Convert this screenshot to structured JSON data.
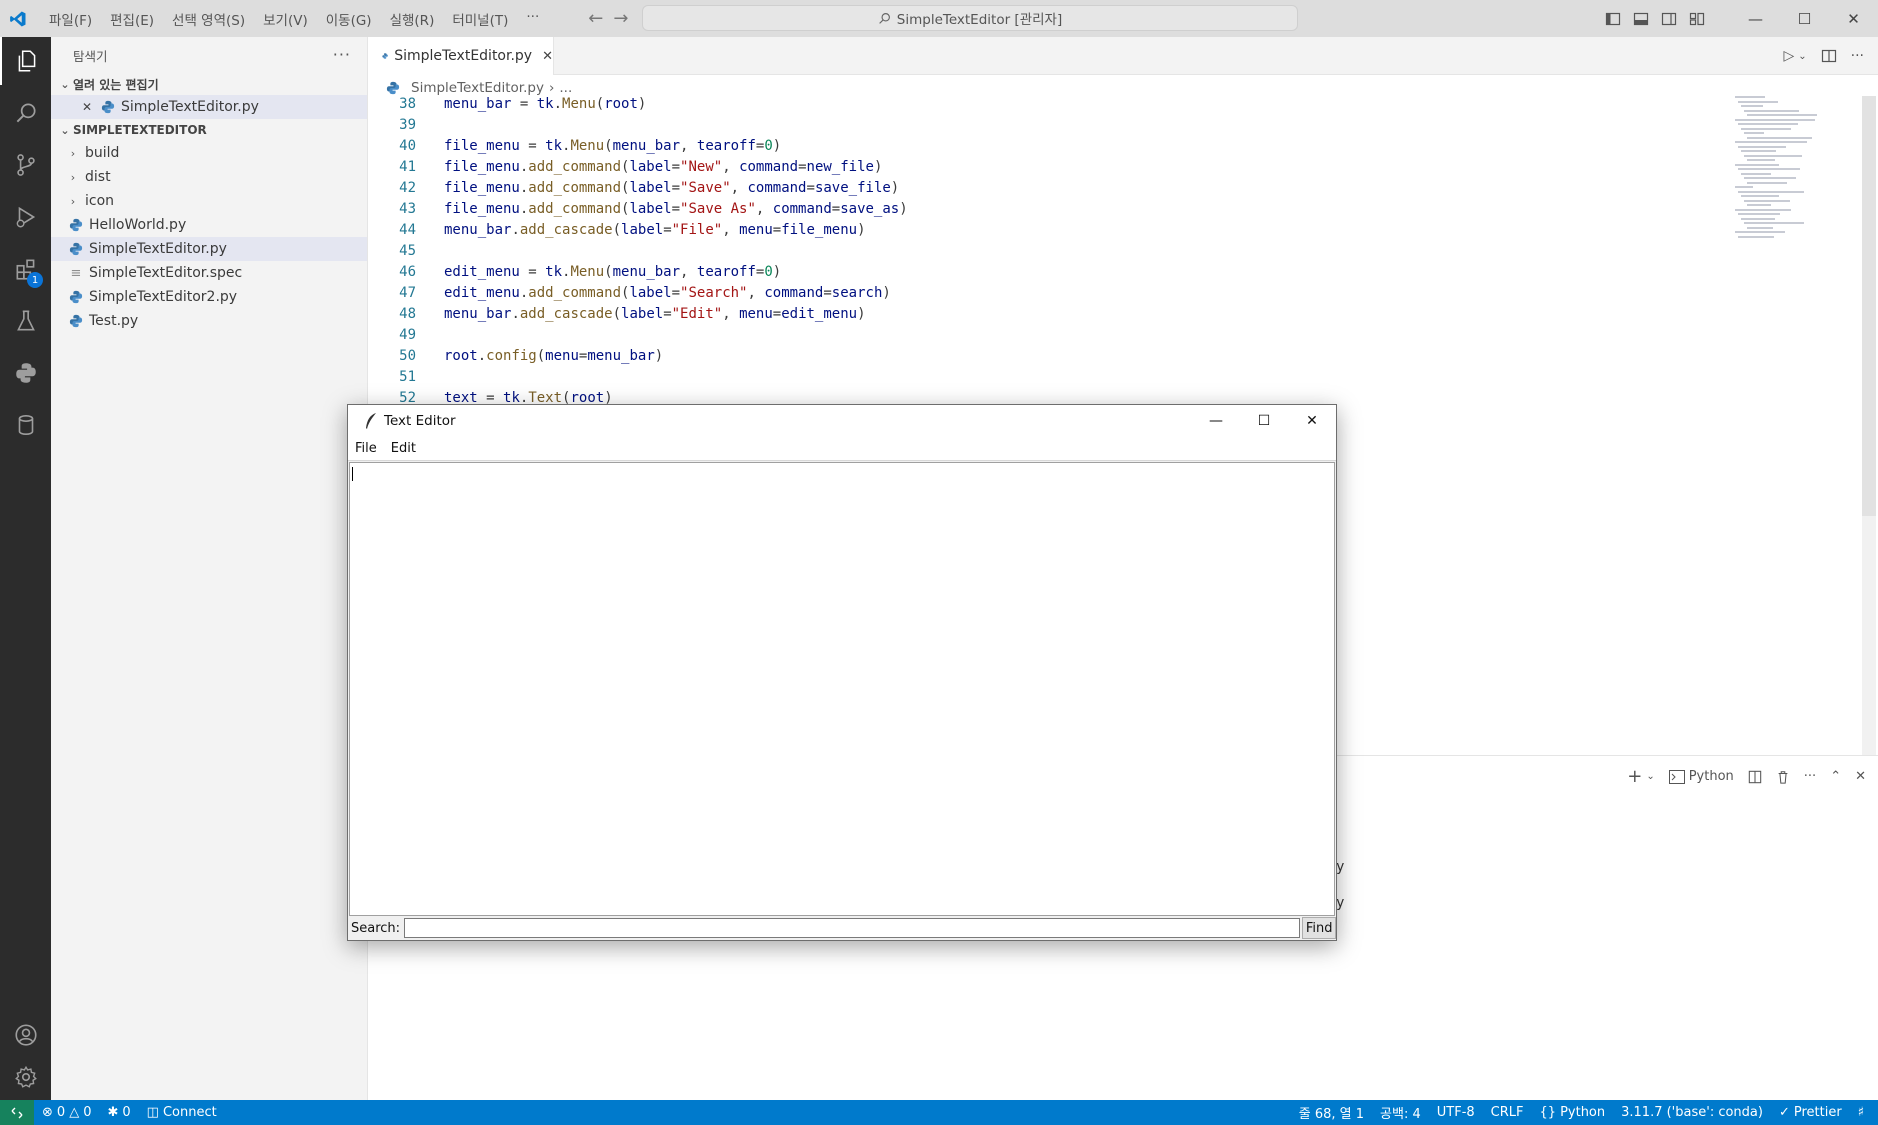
{
  "titlebar": {
    "menus": [
      "파일(F)",
      "편집(E)",
      "선택 영역(S)",
      "보기(V)",
      "이동(G)",
      "실행(R)",
      "터미널(T)",
      "···"
    ],
    "command_center": "SimpleTextEditor [관리자]"
  },
  "sidebar": {
    "title": "탐색기",
    "open_editors_header": "열려 있는 편집기",
    "open_editor_file": "SimpleTextEditor.py",
    "project_header": "SIMPLETEXTEDITOR",
    "folders": [
      "build",
      "dist",
      "icon"
    ],
    "files": [
      "HelloWorld.py",
      "SimpleTextEditor.py",
      "SimpleTextEditor.spec",
      "SimpleTextEditor2.py",
      "Test.py"
    ]
  },
  "editor": {
    "tab_label": "SimpleTextEditor.py",
    "breadcrumb_file": "SimpleTextEditor.py",
    "breadcrumb_more": "...",
    "lines": [
      {
        "n": "38",
        "code": "menu_bar = tk.Menu(root)"
      },
      {
        "n": "39",
        "code": ""
      },
      {
        "n": "40",
        "code": "file_menu = tk.Menu(menu_bar, tearoff=0)"
      },
      {
        "n": "41",
        "code": "file_menu.add_command(label=\"New\", command=new_file)"
      },
      {
        "n": "42",
        "code": "file_menu.add_command(label=\"Save\", command=save_file)"
      },
      {
        "n": "43",
        "code": "file_menu.add_command(label=\"Save As\", command=save_as)"
      },
      {
        "n": "44",
        "code": "menu_bar.add_cascade(label=\"File\", menu=file_menu)"
      },
      {
        "n": "45",
        "code": ""
      },
      {
        "n": "46",
        "code": "edit_menu = tk.Menu(menu_bar, tearoff=0)"
      },
      {
        "n": "47",
        "code": "edit_menu.add_command(label=\"Search\", command=search)"
      },
      {
        "n": "48",
        "code": "menu_bar.add_cascade(label=\"Edit\", menu=edit_menu)"
      },
      {
        "n": "49",
        "code": ""
      },
      {
        "n": "50",
        "code": "root.config(menu=menu_bar)"
      },
      {
        "n": "51",
        "code": ""
      },
      {
        "n": "52",
        "code": "text = tk.Text(root)"
      }
    ]
  },
  "panel": {
    "terminal_label": "Python",
    "partial_text_1": "y",
    "partial_text_2": "y"
  },
  "statusbar": {
    "errors": "0",
    "warnings": "0",
    "ports": "0",
    "connect": "Connect",
    "position": "줄 68, 열 1",
    "spaces": "공백: 4",
    "encoding": "UTF-8",
    "eol": "CRLF",
    "language": "Python",
    "interpreter": "3.11.7 ('base': conda)",
    "formatter": "Prettier"
  },
  "tk_window": {
    "title": "Text Editor",
    "menus": [
      "File",
      "Edit"
    ],
    "search_label": "Search:",
    "search_value": "",
    "find_button": "Find"
  },
  "colors": {
    "activity_bar": "#2c2c2c",
    "status_bar": "#007acc",
    "remote_indicator": "#16825d",
    "badge": "#0a74d8"
  }
}
